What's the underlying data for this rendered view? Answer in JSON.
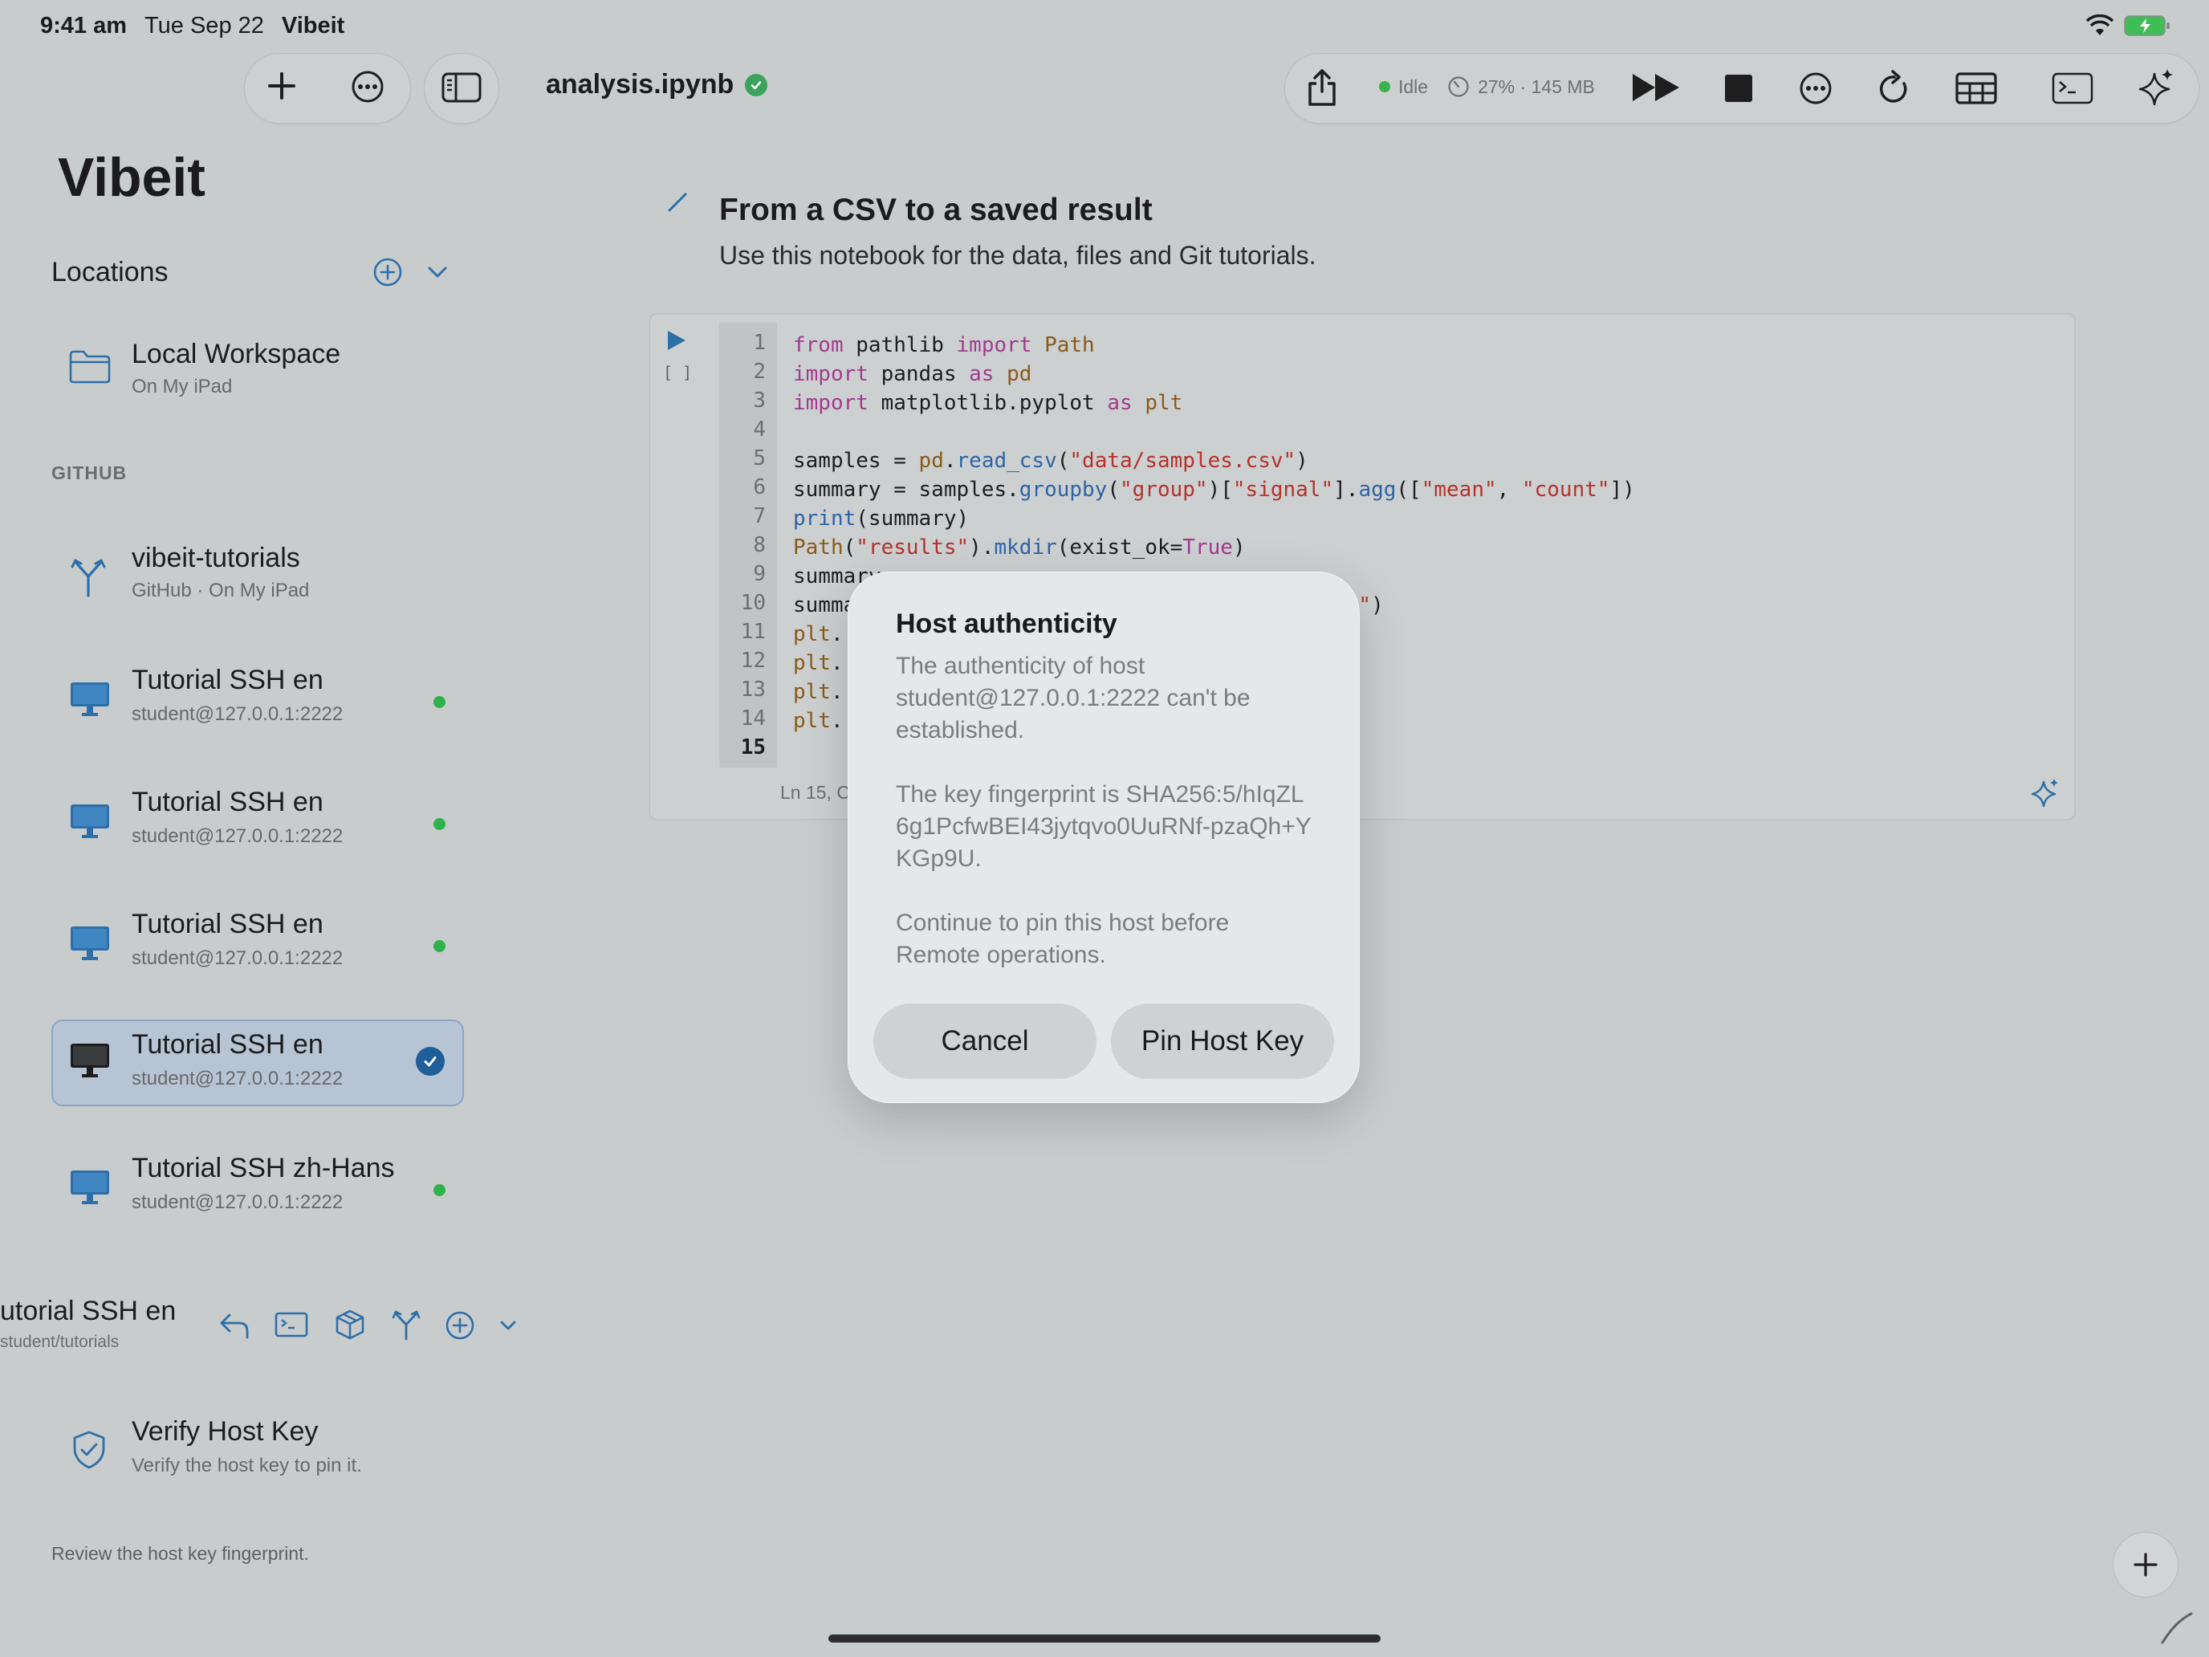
{
  "status_bar": {
    "time": "9:41 am",
    "date": "Tue Sep 22",
    "app": "Vibeit"
  },
  "toolbar": {
    "filename": "analysis.ipynb",
    "kernel_state": "Idle",
    "resource_usage": "27% · 145 MB",
    "icons": [
      "plus-icon",
      "ellipsis-icon",
      "sidebar-icon",
      "share-icon",
      "gauge-icon",
      "run-all-icon",
      "stop-icon",
      "more-icon",
      "restart-icon",
      "table-icon",
      "terminal-icon",
      "sparkles-icon"
    ]
  },
  "sidebar": {
    "brand": "Vibeit",
    "locations_title": "Locations",
    "local": {
      "title": "Local Workspace",
      "sub": "On My iPad"
    },
    "github_caption": "GITHUB",
    "items": [
      {
        "title": "vibeit-tutorials",
        "sub": "GitHub · On My iPad",
        "icon": "branch-icon"
      },
      {
        "title": "Tutorial SSH en",
        "sub": "student@127.0.0.1:2222",
        "icon": "desktop-icon",
        "status": "connected"
      },
      {
        "title": "Tutorial SSH en",
        "sub": "student@127.0.0.1:2222",
        "icon": "desktop-icon",
        "status": "connected"
      },
      {
        "title": "Tutorial SSH en",
        "sub": "student@127.0.0.1:2222",
        "icon": "desktop-icon",
        "status": "connected"
      },
      {
        "title": "Tutorial SSH en",
        "sub": "student@127.0.0.1:2222",
        "icon": "desktop-icon",
        "status": "selected"
      },
      {
        "title": "Tutorial SSH zh-Hans",
        "sub": "student@127.0.0.1:2222",
        "icon": "desktop-icon",
        "status": "connected"
      }
    ],
    "current_location": {
      "title": "utorial SSH en",
      "path": "student/tutorials"
    },
    "verify": {
      "title": "Verify Host Key",
      "sub": "Verify the host key to pin it."
    },
    "hint": "Review the host key fingerprint."
  },
  "notebook": {
    "markdown_title": "From a CSV to a saved result",
    "markdown_body": "Use this notebook for the data, files and Git tutorials.",
    "exec_count": "[ ]",
    "line_numbers": [
      "1",
      "2",
      "3",
      "4",
      "5",
      "6",
      "7",
      "8",
      "9",
      "10",
      "11",
      "12",
      "13",
      "14",
      "15"
    ],
    "cell_footer": "Ln 15, C"
  },
  "dialog": {
    "title": "Host authenticity",
    "msg1": "The authenticity of host student@127.0.0.1:2222 can't be established.",
    "msg2": "The key fingerprint is SHA256:5/hIqZL6g1PcfwBEI43jytqvo0UuRNf-pzaQh+YKGp9U.",
    "msg3": "Continue to pin this host before Remote operations.",
    "cancel": "Cancel",
    "confirm": "Pin Host Key"
  },
  "colors": {
    "accent": "#2d6fa8",
    "status_green": "#30b24a",
    "selected_bg": "#b7c4d3"
  }
}
